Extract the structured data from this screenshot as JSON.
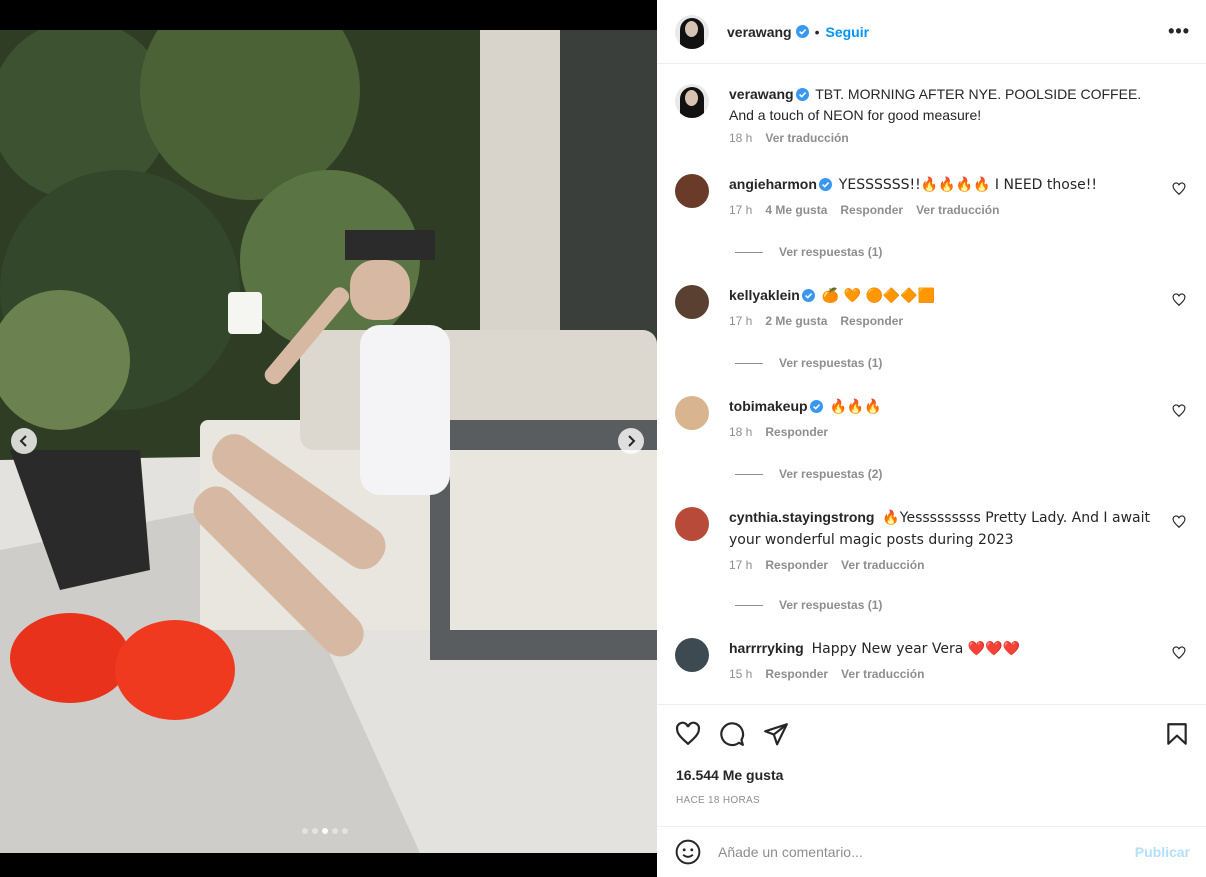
{
  "post": {
    "author": "verawang",
    "follow_label": "Seguir",
    "separator": "•",
    "more_label": "•••",
    "caption": {
      "user": "verawang",
      "text": "TBT. MORNING AFTER NYE. POOLSIDE COFFEE. And a touch of NEON for good measure!",
      "time": "18 h",
      "translate": "Ver traducción"
    },
    "likes": "16.544 Me gusta",
    "time_ago": "HACE 18 HORAS",
    "carousel": {
      "count": 5,
      "active_index": 2
    }
  },
  "comments": [
    {
      "user": "angieharmon",
      "verified": true,
      "text": "YESSSSSS!!🔥🔥🔥🔥 I NEED those!!",
      "time": "17 h",
      "likes": "4 Me gusta",
      "reply": "Responder",
      "translate": "Ver traducción",
      "replies": "Ver respuestas (1)"
    },
    {
      "user": "kellyaklein",
      "verified": true,
      "text": "🍊 🧡 🟠🔶🔶🟧",
      "time": "17 h",
      "likes": "2 Me gusta",
      "reply": "Responder",
      "replies": "Ver respuestas (1)"
    },
    {
      "user": "tobimakeup",
      "verified": true,
      "text": "🔥🔥🔥",
      "time": "18 h",
      "reply": "Responder",
      "replies": "Ver respuestas (2)"
    },
    {
      "user": "cynthia.stayingstrong",
      "verified": false,
      "text": "🔥Yesssssssss Pretty Lady. And I await your wonderful magic posts during 2023",
      "time": "17 h",
      "reply": "Responder",
      "translate": "Ver traducción",
      "replies": "Ver respuestas (1)"
    },
    {
      "user": "harrrryking",
      "verified": false,
      "text": "Happy New year Vera ❤️❤️❤️",
      "time": "15 h",
      "reply": "Responder",
      "translate": "Ver traducción"
    }
  ],
  "comment_box": {
    "placeholder": "Añade un comentario...",
    "publish": "Publicar"
  },
  "icons": {
    "header": [
      "verified-icon",
      "more-options-icon"
    ],
    "actions": [
      "like-heart-icon",
      "comment-bubble-icon",
      "share-send-icon",
      "save-bookmark-icon"
    ],
    "composer": [
      "emoji-smiley-icon"
    ],
    "media": [
      "chevron-left-icon",
      "chevron-right-icon"
    ]
  },
  "colors": {
    "accent": "#0095f6",
    "verified": "#3897f0",
    "publish_disabled": "#b2dffc",
    "muted": "#8e8e8e"
  }
}
